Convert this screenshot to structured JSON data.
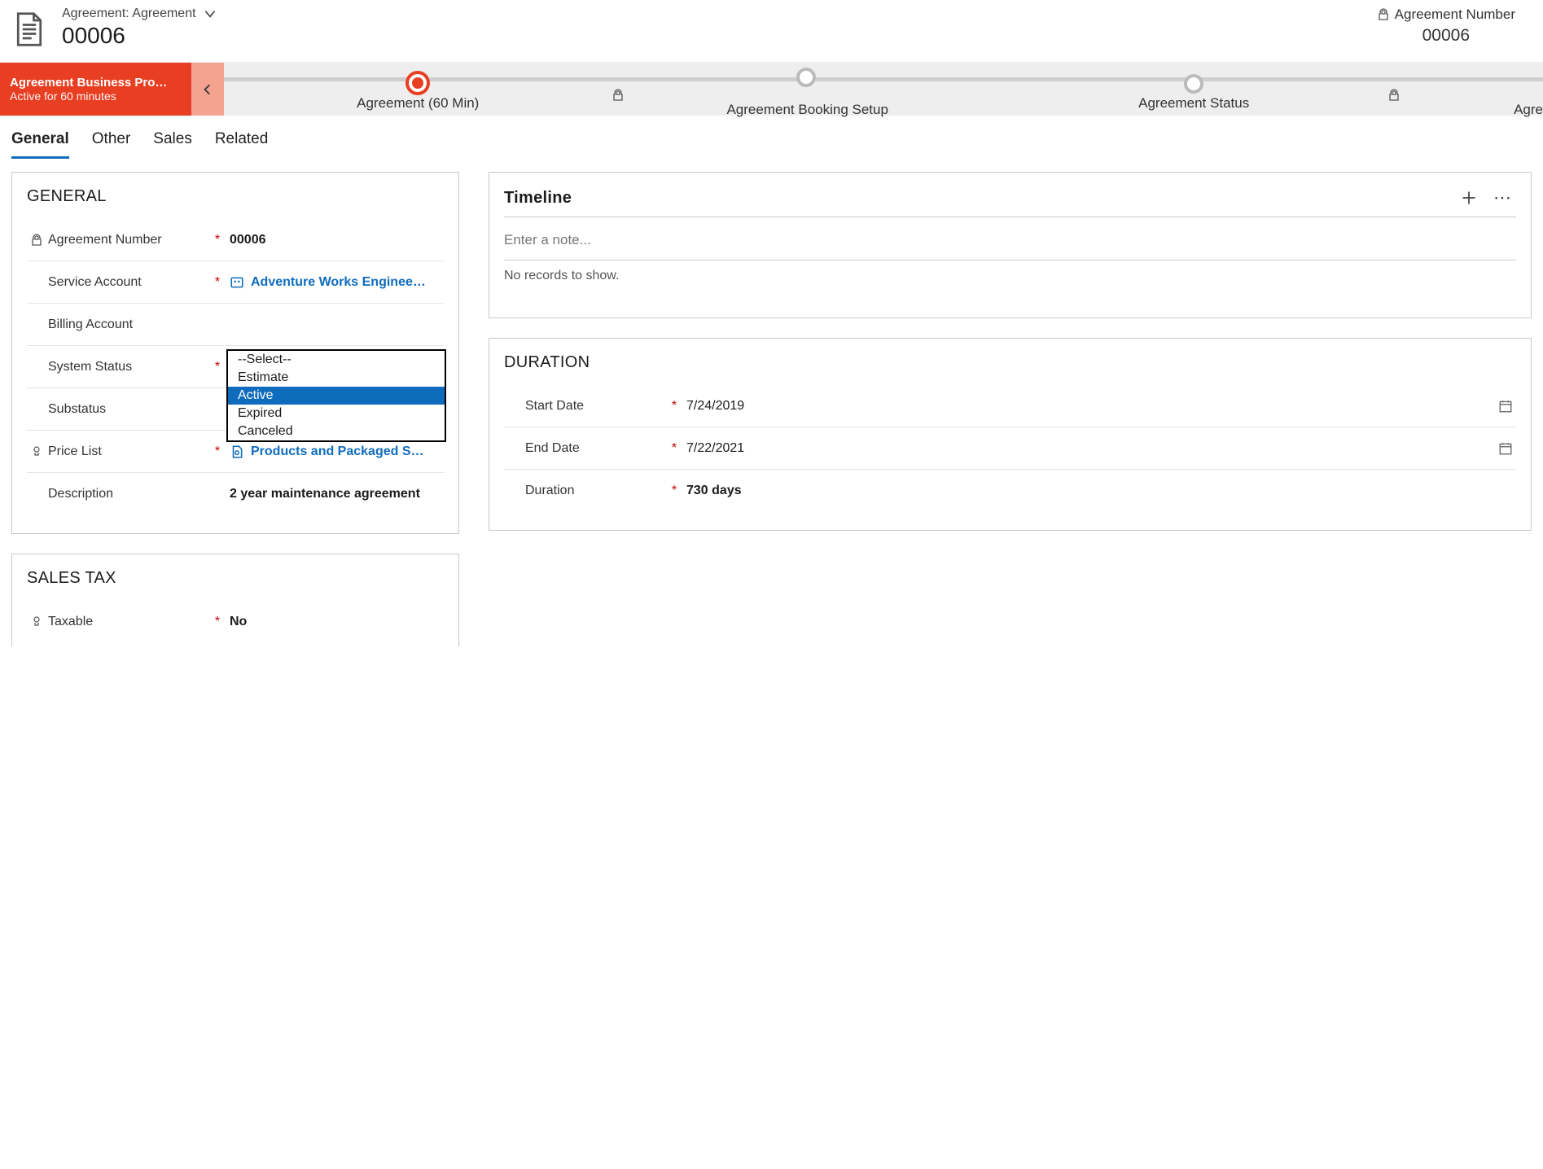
{
  "header": {
    "breadcrumb": "Agreement: Agreement",
    "record_title": "00006",
    "right_label": "Agreement Number",
    "right_value": "00006"
  },
  "process": {
    "name": "Agreement Business Pro…",
    "sub": "Active for 60 minutes",
    "stages": [
      {
        "label": "Agreement  (60 Min)",
        "active": true,
        "locked": false
      },
      {
        "label": "Agreement Booking Setup",
        "active": false,
        "locked": true
      },
      {
        "label": "Agreement Status",
        "active": false,
        "locked": false
      },
      {
        "label": "Agre",
        "active": false,
        "locked": true
      }
    ]
  },
  "tabs": [
    "General",
    "Other",
    "Sales",
    "Related"
  ],
  "active_tab": "General",
  "general_section": {
    "title": "GENERAL",
    "fields": {
      "agreement_number": {
        "label": "Agreement Number",
        "value": "00006",
        "required": true,
        "locked": true
      },
      "service_account": {
        "label": "Service Account",
        "value": "Adventure Works Enginee…",
        "required": true
      },
      "billing_account": {
        "label": "Billing Account",
        "value": "",
        "required": false
      },
      "system_status": {
        "label": "System Status",
        "required": true,
        "options": [
          "--Select--",
          "Estimate",
          "Active",
          "Expired",
          "Canceled"
        ],
        "selected": "Active"
      },
      "substatus": {
        "label": "Substatus",
        "value": "",
        "required": false
      },
      "price_list": {
        "label": "Price List",
        "value": "Products and Packaged S…",
        "required": true
      },
      "description": {
        "label": "Description",
        "value": "2 year maintenance agreement",
        "required": false
      }
    }
  },
  "timeline": {
    "title": "Timeline",
    "placeholder": "Enter a note...",
    "empty": "No records to show."
  },
  "duration_section": {
    "title": "DURATION",
    "start_date": {
      "label": "Start Date",
      "value": "7/24/2019",
      "required": true
    },
    "end_date": {
      "label": "End Date",
      "value": "7/22/2021",
      "required": true
    },
    "duration": {
      "label": "Duration",
      "value": "730 days",
      "required": true
    }
  },
  "sales_tax_section": {
    "title": "SALES TAX",
    "taxable": {
      "label": "Taxable",
      "value": "No",
      "required": true
    }
  }
}
